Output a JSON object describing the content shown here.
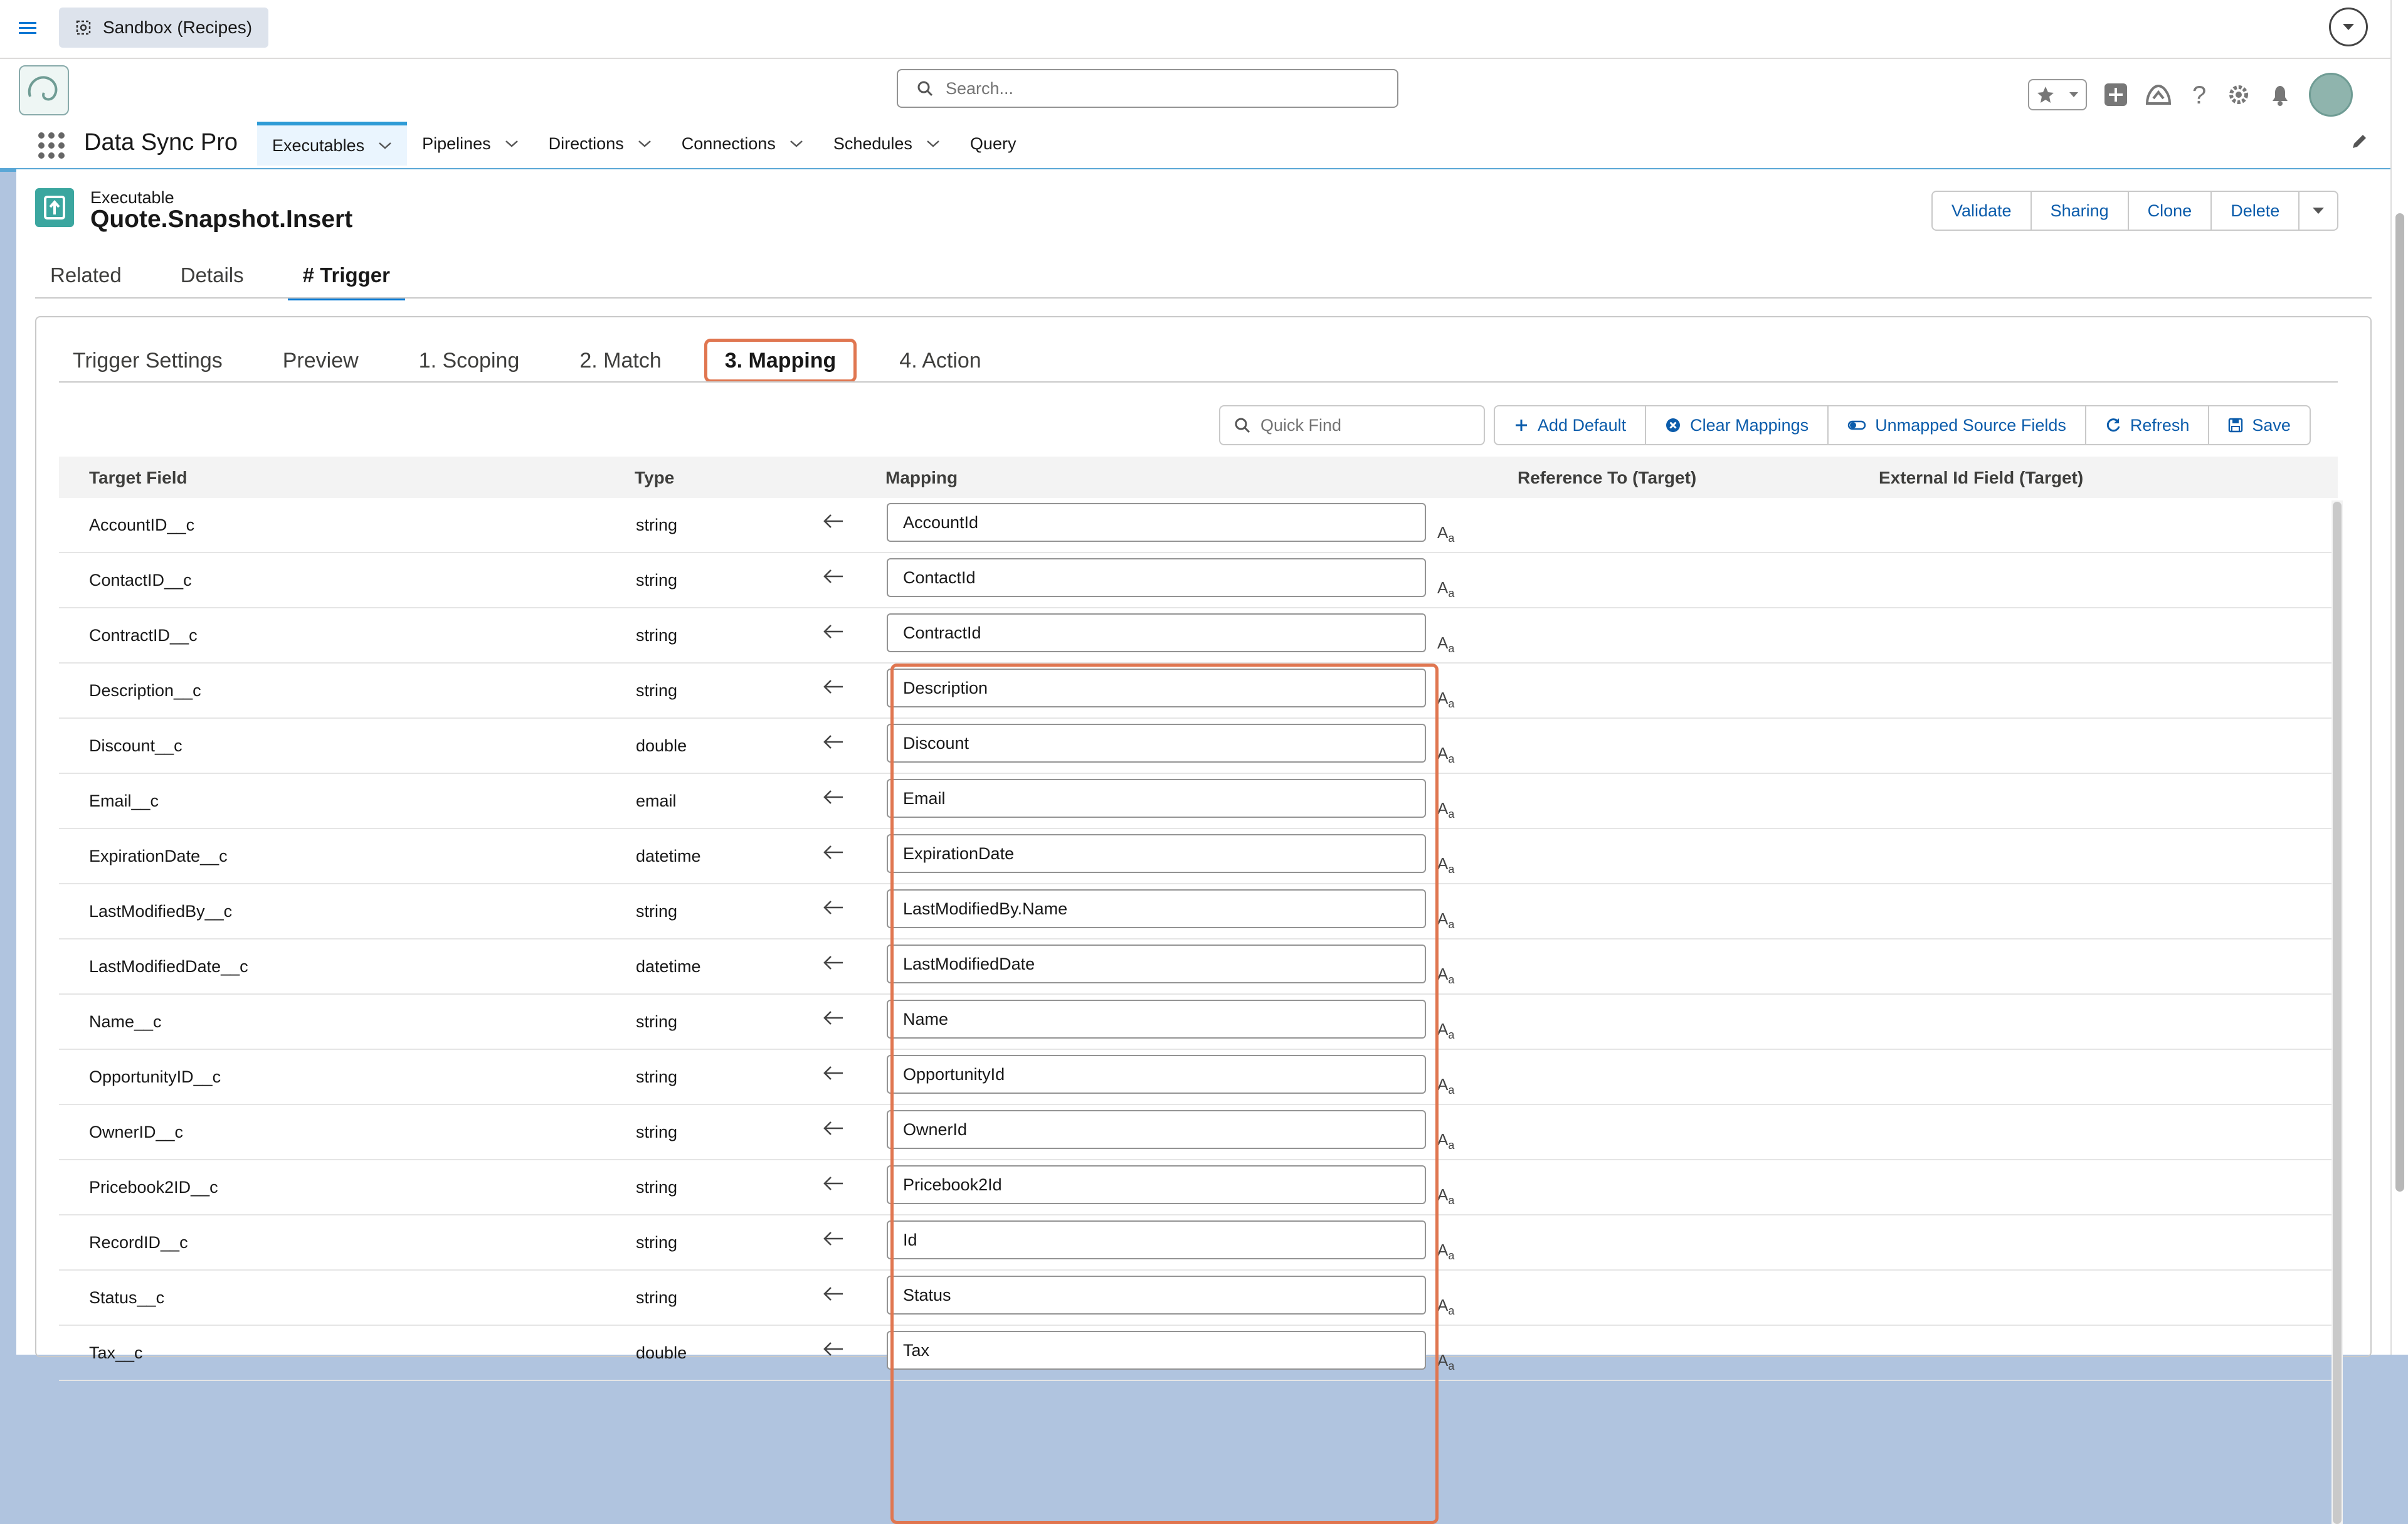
{
  "topbar": {
    "sandbox_label": "Sandbox (Recipes)"
  },
  "header": {
    "search_placeholder": "Search...",
    "app_name": "Data Sync Pro"
  },
  "nav": {
    "tabs": [
      {
        "label": "Executables",
        "dropdown": true,
        "active": true
      },
      {
        "label": "Pipelines",
        "dropdown": true
      },
      {
        "label": "Directions",
        "dropdown": true
      },
      {
        "label": "Connections",
        "dropdown": true
      },
      {
        "label": "Schedules",
        "dropdown": true
      },
      {
        "label": "Query",
        "dropdown": false
      }
    ]
  },
  "record": {
    "object_label": "Executable",
    "title": "Quote.Snapshot.Insert",
    "actions": [
      "Validate",
      "Sharing",
      "Clone",
      "Delete"
    ]
  },
  "record_tabs": [
    "Related",
    "Details",
    "# Trigger"
  ],
  "active_record_tab": "# Trigger",
  "sub_tabs": [
    "Trigger Settings",
    "Preview",
    "1. Scoping",
    "2. Match",
    "3. Mapping",
    "4. Action"
  ],
  "active_sub_tab": "3. Mapping",
  "toolbar": {
    "quick_find_placeholder": "Quick Find",
    "buttons": [
      "Add Default",
      "Clear Mappings",
      "Unmapped Source Fields",
      "Refresh",
      "Save"
    ]
  },
  "table": {
    "headers": [
      "Target Field",
      "Type",
      "Mapping",
      "Reference To (Target)",
      "External Id Field (Target)"
    ],
    "rows": [
      {
        "target": "AccountID__c",
        "type": "string",
        "mapping": "AccountId"
      },
      {
        "target": "ContactID__c",
        "type": "string",
        "mapping": "ContactId"
      },
      {
        "target": "ContractID__c",
        "type": "string",
        "mapping": "ContractId"
      },
      {
        "target": "Description__c",
        "type": "string",
        "mapping": "Description"
      },
      {
        "target": "Discount__c",
        "type": "double",
        "mapping": "Discount"
      },
      {
        "target": "Email__c",
        "type": "email",
        "mapping": "Email"
      },
      {
        "target": "ExpirationDate__c",
        "type": "datetime",
        "mapping": "ExpirationDate"
      },
      {
        "target": "LastModifiedBy__c",
        "type": "string",
        "mapping": "LastModifiedBy.Name"
      },
      {
        "target": "LastModifiedDate__c",
        "type": "datetime",
        "mapping": "LastModifiedDate"
      },
      {
        "target": "Name__c",
        "type": "string",
        "mapping": "Name"
      },
      {
        "target": "OpportunityID__c",
        "type": "string",
        "mapping": "OpportunityId"
      },
      {
        "target": "OwnerID__c",
        "type": "string",
        "mapping": "OwnerId"
      },
      {
        "target": "Pricebook2ID__c",
        "type": "string",
        "mapping": "Pricebook2Id"
      },
      {
        "target": "RecordID__c",
        "type": "string",
        "mapping": "Id"
      },
      {
        "target": "Status__c",
        "type": "string",
        "mapping": "Status"
      },
      {
        "target": "Tax__c",
        "type": "double",
        "mapping": "Tax"
      }
    ]
  },
  "colors": {
    "accent": "#0176d3",
    "highlight": "#e07650",
    "record_icon": "#3ba69f"
  }
}
